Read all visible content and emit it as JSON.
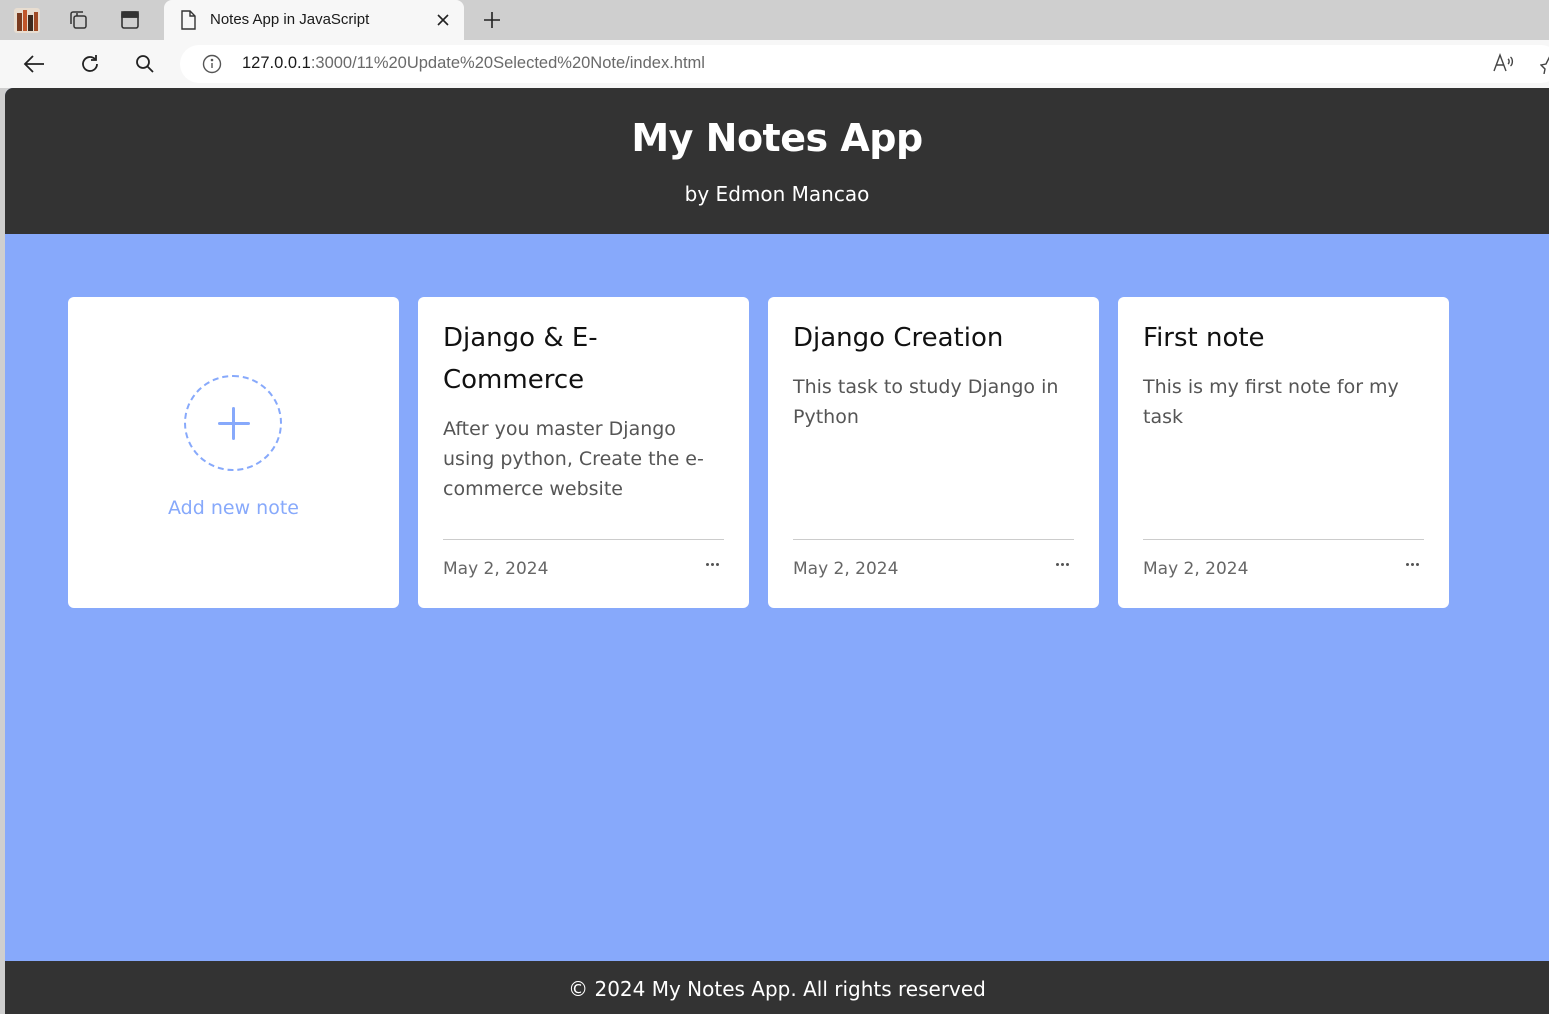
{
  "browser": {
    "tab_title": "Notes App in JavaScript",
    "url_host": "127.0.0.1",
    "url_rest": ":3000/11%20Update%20Selected%20Note/index.html",
    "icons": {
      "workspaces": "workspaces-icon",
      "tab_actions": "tab-actions-icon",
      "document": "document-icon",
      "close": "close-icon",
      "new_tab": "plus-icon",
      "back": "back-arrow-icon",
      "refresh": "refresh-icon",
      "search": "search-icon",
      "info": "info-icon",
      "read_aloud": "read-aloud-icon",
      "favorite": "star-icon"
    }
  },
  "header": {
    "title": "My Notes App",
    "subtitle": "by Edmon Mancao"
  },
  "add_note": {
    "label": "Add new note"
  },
  "notes": [
    {
      "title": "Django & E-Commerce",
      "description": "After you master Django using python, Create the e-commerce website",
      "date": "May 2, 2024"
    },
    {
      "title": "Django Creation",
      "description": "This task to study Django in Python",
      "date": "May 2, 2024"
    },
    {
      "title": "First note",
      "description": "This is my first note for my task",
      "date": "May 2, 2024"
    }
  ],
  "footer": {
    "text": "© 2024 My Notes App. All rights reserved"
  },
  "colors": {
    "header_bg": "#333333",
    "page_bg": "#87a9fb",
    "accent": "#87a9fb",
    "card_bg": "#ffffff"
  }
}
